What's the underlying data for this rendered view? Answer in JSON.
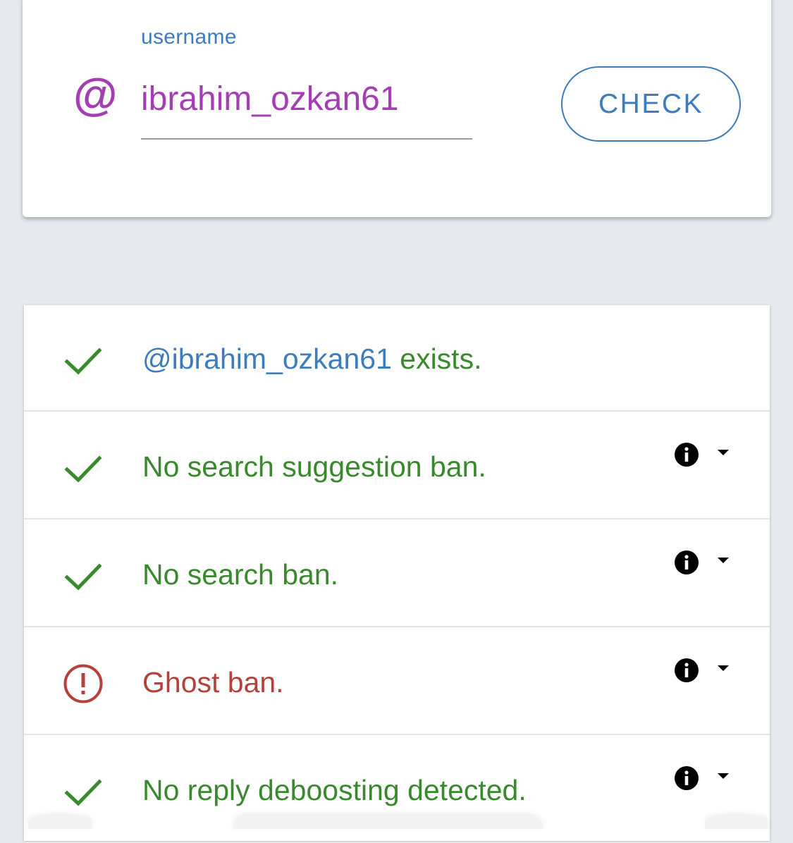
{
  "search": {
    "label": "username",
    "at_symbol": "@",
    "username_value": "ibrahim_ozkan61",
    "check_label": "CHECK"
  },
  "results": [
    {
      "status": "ok",
      "icon": "check-icon",
      "handle": "@ibrahim_ozkan61",
      "text": " exists.",
      "has_details": false
    },
    {
      "status": "ok",
      "icon": "check-icon",
      "text": "No search suggestion ban.",
      "has_details": true
    },
    {
      "status": "ok",
      "icon": "check-icon",
      "text": "No search ban.",
      "has_details": true
    },
    {
      "status": "error",
      "icon": "alert-circle-icon",
      "text": "Ghost ban.",
      "has_details": true
    },
    {
      "status": "ok",
      "icon": "check-icon",
      "text": "No reply deboosting detected.",
      "has_details": true
    }
  ],
  "colors": {
    "background": "#e6eaee",
    "accent_blue": "#3d7cbf",
    "username_purple": "#a33fb3",
    "ok_green": "#398a2c",
    "error_red": "#b5413b"
  }
}
